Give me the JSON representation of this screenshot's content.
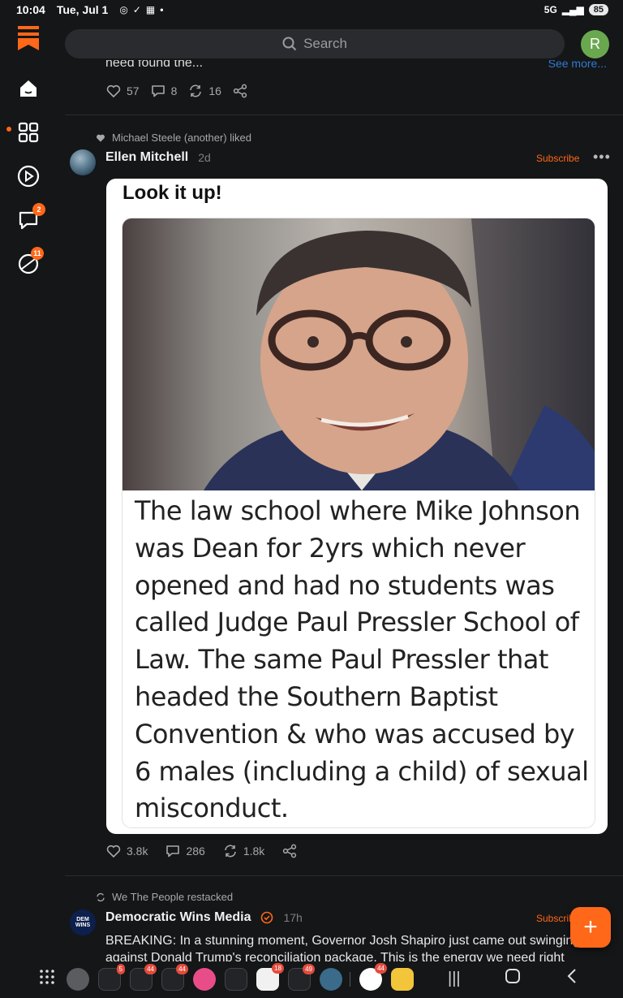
{
  "status_bar": {
    "time": "10:04",
    "date": "Tue, Jul 1",
    "network": "5G",
    "battery": "85"
  },
  "search": {
    "placeholder": "Search"
  },
  "profile_initial": "R",
  "rail": {
    "chat_badge": "2",
    "activity_badge": "11"
  },
  "previous_post": {
    "clipped_text": "need found the...",
    "see_more": "See more...",
    "likes": "57",
    "comments": "8",
    "restacks": "16"
  },
  "post": {
    "liked_by": "Michael Steele (another) liked",
    "author": "Ellen Mitchell",
    "age": "2d",
    "subscribe_label": "Subscribe",
    "title": "Look it up!",
    "image_caption": "The law school where Mike Johnson was Dean for 2yrs which never opened and had no students was called Judge Paul Pressler School of Law. The same Paul Pressler that headed the Southern Baptist Convention & who was accused by 6 males (including a child) of sexual misconduct.",
    "likes": "3.8k",
    "comments": "286",
    "restacks": "1.8k"
  },
  "next_post": {
    "restacked_by": "We The People restacked",
    "author": "Democratic Wins Media",
    "age": "17h",
    "avatar_text": "DEM WINS",
    "subscribe_label": "Subscribe",
    "text": "BREAKING: In a stunning moment, Governor Josh Shapiro just came out swinging against Donald Trump's reconciliation package. This is the energy we need right"
  },
  "taskbar": {
    "badges": [
      "5",
      "44",
      "44",
      "18",
      "49",
      "44"
    ]
  },
  "colors": {
    "accent": "#ff6719",
    "background": "#151618",
    "link": "#2f7bd3"
  }
}
